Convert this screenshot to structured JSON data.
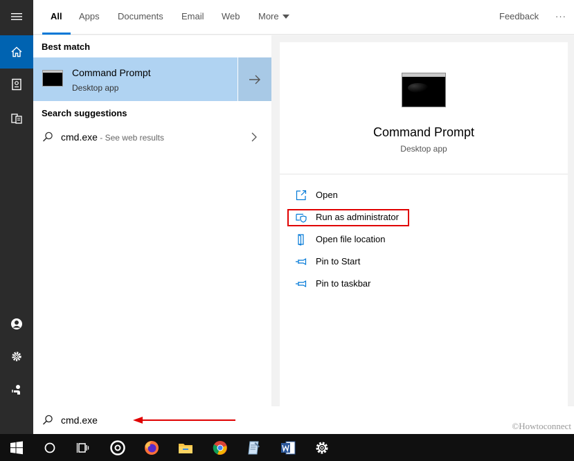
{
  "colors": {
    "accent": "#0078d7",
    "rail_bg": "#2b2b2b",
    "rail_active": "#0063b1",
    "best_match_bg": "#b0d3f2",
    "highlight": "#e00000",
    "taskbar_bg": "#101010"
  },
  "tabs": [
    {
      "label": "All",
      "active": true
    },
    {
      "label": "Apps"
    },
    {
      "label": "Documents"
    },
    {
      "label": "Email"
    },
    {
      "label": "Web"
    },
    {
      "label": "More"
    }
  ],
  "feedback_label": "Feedback",
  "more_options_label": "···",
  "rail": {
    "icons": [
      "hamburger-icon",
      "home-icon",
      "notebook-icon",
      "documents-icon",
      "user-icon",
      "settings-icon",
      "feedback-icon"
    ]
  },
  "results": {
    "best_match_heading": "Best match",
    "best_match": {
      "title": "Command Prompt",
      "subtitle": "Desktop app"
    },
    "suggestions_heading": "Search suggestions",
    "suggestion": {
      "query": "cmd.exe",
      "hint": " - See web results"
    }
  },
  "detail": {
    "title": "Command Prompt",
    "subtitle": "Desktop app",
    "actions": [
      {
        "label": "Open",
        "icon": "open-icon"
      },
      {
        "label": "Run as administrator",
        "icon": "shield-icon"
      },
      {
        "label": "Open file location",
        "icon": "file-location-icon"
      },
      {
        "label": "Pin to Start",
        "icon": "pin-icon"
      },
      {
        "label": "Pin to taskbar",
        "icon": "pin-icon"
      }
    ]
  },
  "search": {
    "value": "cmd.exe",
    "placeholder": ""
  },
  "watermark": "©Howtoconnect",
  "taskbar": {
    "icons": [
      "windows-start-icon",
      "cortana-icon",
      "task-view-icon",
      "groove-icon",
      "firefox-icon",
      "file-explorer-icon",
      "chrome-icon",
      "notepad-icon",
      "word-icon",
      "settings-icon"
    ]
  }
}
